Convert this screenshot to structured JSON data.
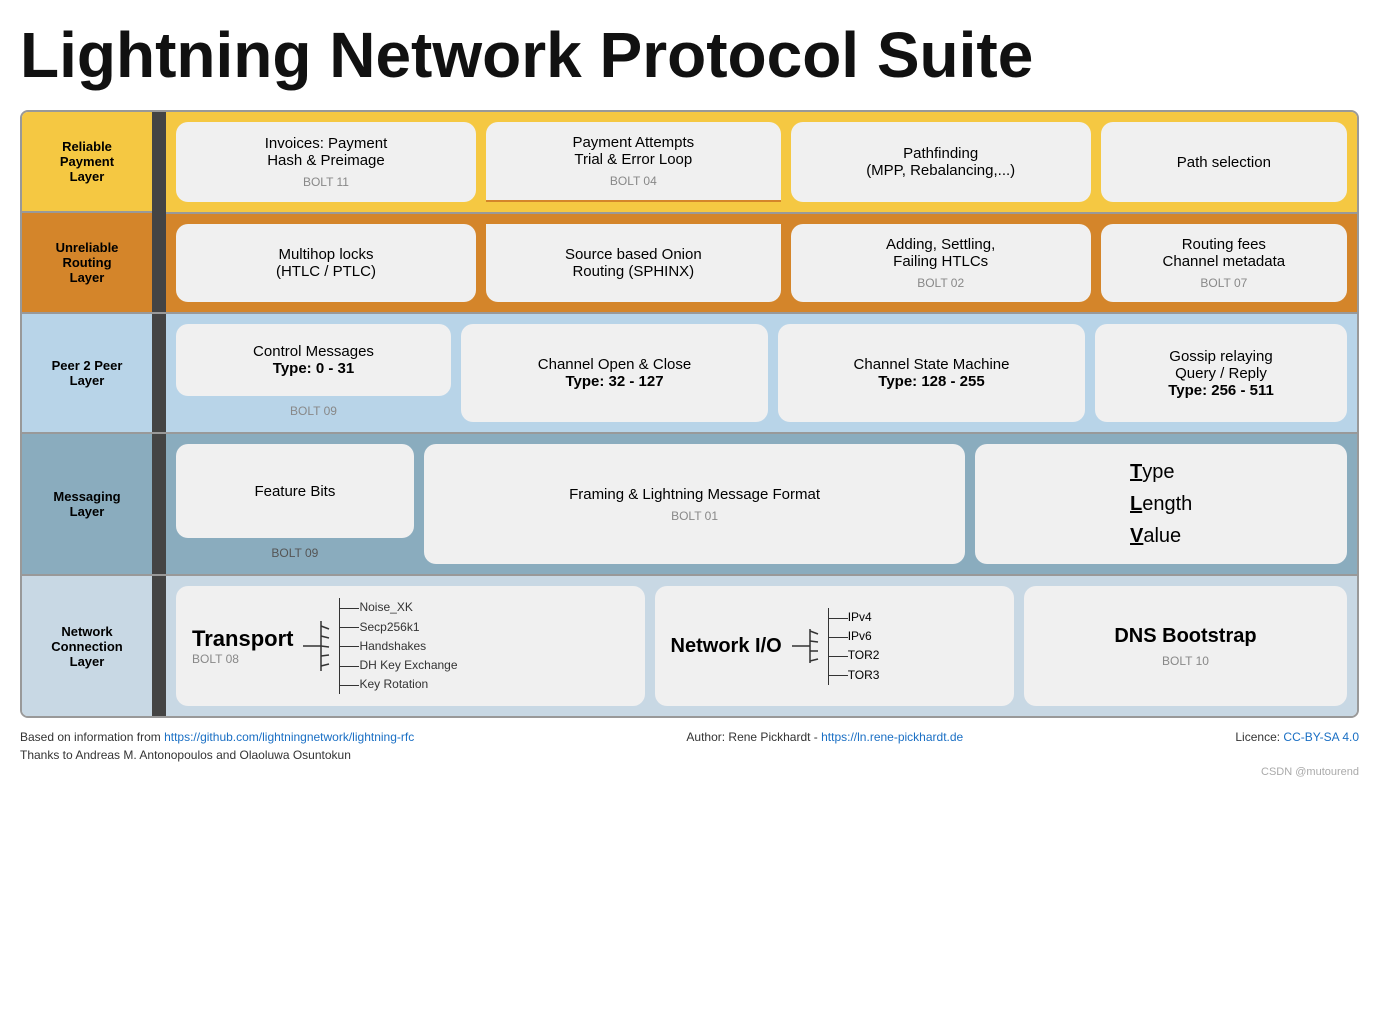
{
  "title": "Lightning Network Protocol Suite",
  "layers": {
    "reliable": {
      "label": "Reliable\nPayment\nLayer",
      "bg": "#f5c842",
      "cells": [
        {
          "id": "invoices",
          "text": "Invoices: Payment\nHash & Preimage",
          "bolt": "BOLT 11"
        },
        {
          "id": "payment-attempts",
          "text": "Payment Attempts\nTrial & Error Loop",
          "bolt": "BOLT 04"
        },
        {
          "id": "pathfinding",
          "text": "Pathfinding\n(MPP, Rebalancing,...)",
          "bolt": ""
        },
        {
          "id": "path-selection",
          "text": "Path selection",
          "bolt": ""
        }
      ]
    },
    "unreliable": {
      "label": "Unreliable\nRouting\nLayer",
      "bg": "#d4852a",
      "cells": [
        {
          "id": "multihop",
          "text": "Multihop locks\n(HTLC / PTLC)",
          "bolt": ""
        },
        {
          "id": "onion-routing",
          "text": "Source based Onion\nRouting (SPHINX)",
          "bolt": ""
        },
        {
          "id": "htlcs",
          "text": "Adding, Settling,\nFailing HTLCs",
          "bolt": "BOLT 02"
        },
        {
          "id": "routing-fees",
          "text": "Routing fees\nChannel metadata",
          "bolt": "BOLT 07"
        }
      ]
    },
    "p2p": {
      "label": "Peer 2 Peer\nLayer",
      "bg": "#b8d4e8",
      "cells": [
        {
          "id": "control-messages",
          "text": "Control Messages",
          "bold": "Type: 0 - 31",
          "bolt": "BOLT 09"
        },
        {
          "id": "channel-open-close",
          "text": "Channel Open & Close",
          "bold": "Type: 32 - 127",
          "bolt": ""
        },
        {
          "id": "channel-state",
          "text": "Channel State Machine",
          "bold": "Type: 128 - 255",
          "bolt": ""
        },
        {
          "id": "gossip",
          "text": "Gossip relaying\nQuery / Reply",
          "bold": "Type: 256 - 511",
          "bolt": ""
        }
      ]
    },
    "messaging": {
      "label": "Messaging\nLayer",
      "bg": "#8aacbe",
      "cells": [
        {
          "id": "feature-bits",
          "text": "Feature Bits",
          "bolt": "BOLT 09"
        },
        {
          "id": "framing",
          "text": "Framing & Lightning Message Format",
          "bolt": "BOLT 01"
        },
        {
          "id": "tlv",
          "T": "T",
          "L": "L",
          "V": "V",
          "tword": "Type",
          "lword": "Length",
          "vword": "Value"
        }
      ]
    },
    "network": {
      "label": "Network\nConnection\nLayer",
      "bg": "#c8d8e4",
      "cells": [
        {
          "id": "transport",
          "title": "Transport",
          "bolt": "BOLT 08",
          "branches": [
            "Noise_XK",
            "Secp256k1",
            "Handshakes",
            "DH Key Exchange",
            "Key Rotation"
          ]
        },
        {
          "id": "network-io",
          "title": "Network I/O",
          "branches": [
            "IPv4",
            "IPv6",
            "TOR2",
            "TOR3"
          ]
        },
        {
          "id": "dns-bootstrap",
          "title": "DNS Bootstrap",
          "bolt": "BOLT 10"
        }
      ]
    }
  },
  "footer": {
    "left_text": "Based on information from ",
    "left_link": "https://github.com/lightningnetwork/lightning-rfc",
    "left_link_text": "https://github.com/lightningnetwork/lightning-rfc",
    "center_text": "Author: Rene Pickhardt - ",
    "center_link": "https://ln.rene-pickhardt.de",
    "center_link_text": "https://ln.rene-pickhardt.de",
    "right_text": "Licence: ",
    "right_link_text": "CC-BY-SA 4.0",
    "thanks": "Thanks to Andreas M. Antonopoulos and Olaoluwa Osuntokun",
    "watermark": "CSDN @mutourend"
  }
}
